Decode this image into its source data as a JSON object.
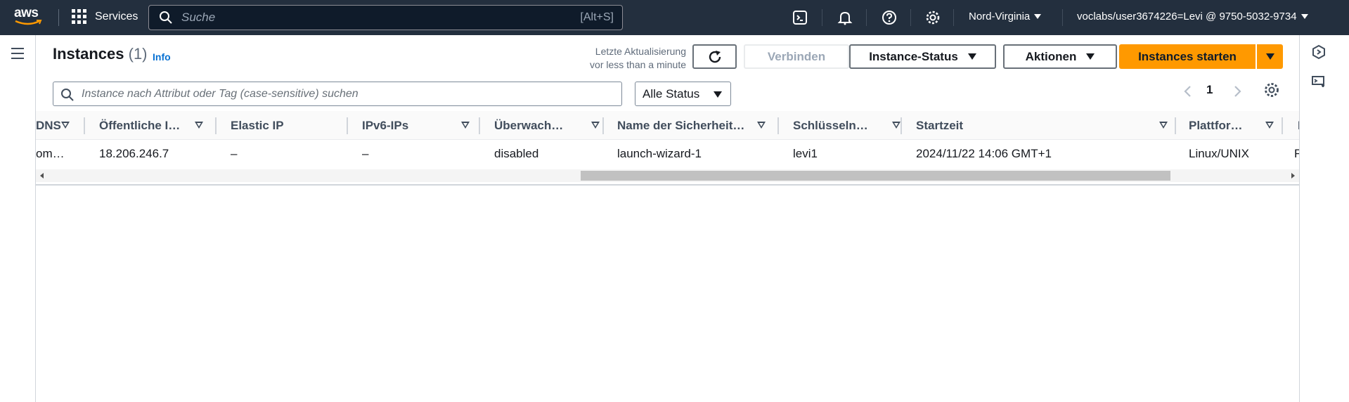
{
  "topnav": {
    "logo_text": "aws",
    "services_label": "Services",
    "search_placeholder": "Suche",
    "search_shortcut": "[Alt+S]",
    "region": "Nord-Virginia",
    "account": "voclabs/user3674226=Levi @ 9750-5032-9734",
    "icons": [
      "cloudshell-icon",
      "bell-icon",
      "help-icon",
      "gear-icon"
    ]
  },
  "page": {
    "title": "Instances",
    "count": "(1)",
    "info_link": "Info",
    "refresh_line1": "Letzte Aktualisierung",
    "refresh_line2": "vor less than a minute",
    "connect_label": "Verbinden",
    "instance_state_label": "Instance-Status",
    "actions_label": "Aktionen",
    "launch_label": "Instances starten",
    "accent_color": "#ff9900"
  },
  "filter": {
    "placeholder": "Instance nach Attribut oder Tag (case-sensitive) suchen",
    "status_select": "Alle Status"
  },
  "pagination": {
    "current_page": "1"
  },
  "table": {
    "columns": [
      "DNS",
      "Öffentliche I…",
      "Elastic IP",
      "IPv6-IPs",
      "Überwach…",
      "Name der Sicherheit…",
      "Schlüsseln…",
      "Startzeit",
      "Plattfor…",
      "N"
    ],
    "rows": [
      {
        "cells": [
          "om…",
          "18.206.246.7",
          "–",
          "–",
          "disabled",
          "launch-wizard-1",
          "levi1",
          "2024/11/22 14:06 GMT+1",
          "Linux/UNIX",
          "F"
        ]
      }
    ]
  }
}
